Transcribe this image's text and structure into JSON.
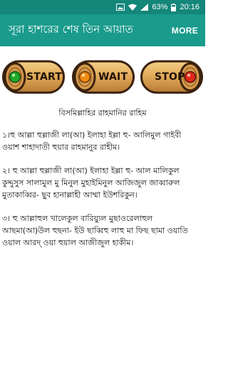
{
  "status_bar": {
    "battery": "63%",
    "time": "20:16"
  },
  "header": {
    "title": "সূরা হাশরের শেষ তিন আয়াত",
    "more_label": "MORE"
  },
  "controls": {
    "start_label": "START",
    "wait_label": "WAIT",
    "stop_label": "STOP",
    "colors": {
      "start": "#22a82a",
      "wait": "#f08a12",
      "stop": "#e02a1a"
    }
  },
  "content": {
    "heading": "বিসমিল্লাহির রাহমানির রাহিম",
    "verses": [
      "১।হু আল্লা হুল্লাজী লা(আ) ইলাহা ইল্লা হু- আলিমুল গাইবী ওয়াশ শাহাদাতী হুয়ার রাহমানুর রাহীম।",
      "২। হু আল্লা হুল্লাজী লা(আ) ইলাহা ইল্লা হু- আল মালিকুল কুদ্দুসুস সালামুল মু মিনুল মুহাইমিনুল আজিজুল জাব্বারুল মুতাকাব্বির- ছুব হানাল্লাহী আম্মা ইউশরিকুন।",
      "৩। হু আল্লাহুল খালেকুল বারিয়্যুল মুছাওরেলাহুল আছমা(আ)উল হুছনা- ইউ ছাব্বিহু লাহু মা ফিছ ছামা ওয়াতি ওয়াল আরদ্ ওয়া হুয়াল আজীজুল হাকীম।"
    ]
  }
}
